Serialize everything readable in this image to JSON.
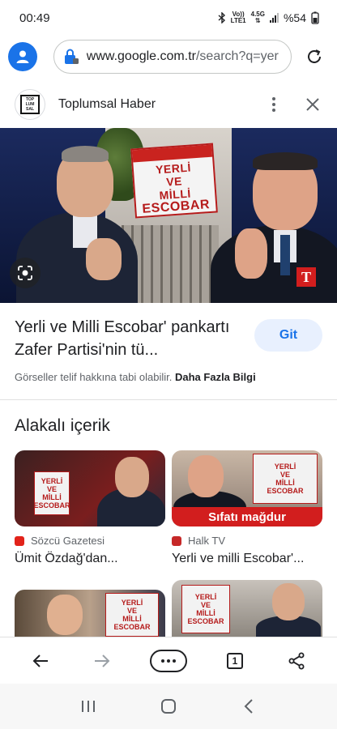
{
  "status_bar": {
    "time": "00:49",
    "network_top": "Vo))",
    "network_bottom": "LTE1",
    "network_gen": "4.5G",
    "battery": "%54"
  },
  "url_bar": {
    "domain": "www.google.com.tr",
    "path": "/search?q=yer"
  },
  "source": {
    "name": "Toplumsal Haber",
    "logo_lines": [
      "TOP",
      "LUM",
      "SAL"
    ]
  },
  "hero": {
    "banner_lines": [
      "YERLİ",
      "VE",
      "MİLLİ",
      "ESCOBAR"
    ],
    "corner_logo": "T"
  },
  "result": {
    "title": "Yerli ve Milli Escobar' pankartı Zafer Partisi'nin tü...",
    "visit_button": "Git",
    "copyright_text": "Görseller telif hakkına tabi olabilir.",
    "more_info": "Daha Fazla Bilgi"
  },
  "related": {
    "heading": "Alakalı içerik",
    "cards": [
      {
        "source": "Sözcü Gazetesi",
        "title": "Ümit Özdağ'dan...",
        "source_color": "#e2231a"
      },
      {
        "source": "Halk TV",
        "title": "Yerli ve milli Escobar'...",
        "source_color": "#c62828",
        "overlay": "Sıfatı mağdur"
      },
      {
        "source": "",
        "title": ""
      },
      {
        "source": "",
        "title": ""
      }
    ]
  },
  "toolbar": {
    "tab_count": "1"
  },
  "colors": {
    "accent": "#1a73e8",
    "git_bg": "#e8f0fe",
    "banner_red": "#b51b1b"
  }
}
